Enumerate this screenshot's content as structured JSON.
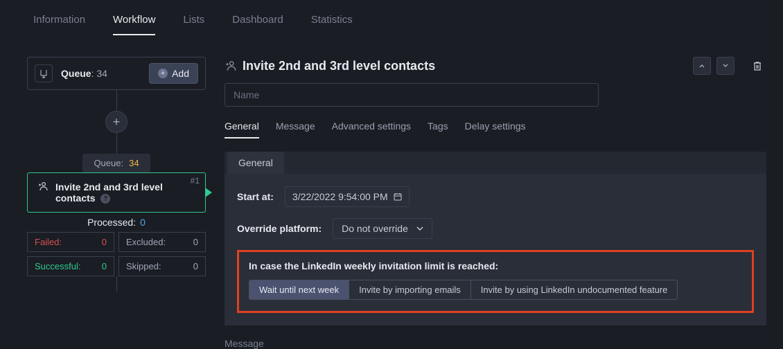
{
  "top_tabs": {
    "information": "Information",
    "workflow": "Workflow",
    "lists": "Lists",
    "dashboard": "Dashboard",
    "statistics": "Statistics"
  },
  "workflow": {
    "queue_label": "Queue",
    "queue_count": "34",
    "add_button": "Add",
    "queue_pill_label": "Queue:",
    "queue_pill_value": "34",
    "step": {
      "number": "#1",
      "title": "Invite 2nd and 3rd level contacts"
    },
    "processed_label": "Processed:",
    "processed_value": "0",
    "status": {
      "failed_label": "Failed:",
      "failed_value": "0",
      "excluded_label": "Excluded:",
      "excluded_value": "0",
      "successful_label": "Successful:",
      "successful_value": "0",
      "skipped_label": "Skipped:",
      "skipped_value": "0"
    }
  },
  "detail": {
    "title": "Invite 2nd and 3rd level contacts",
    "name_placeholder": "Name",
    "sub_tabs": {
      "general": "General",
      "message": "Message",
      "advanced": "Advanced settings",
      "tags": "Tags",
      "delay": "Delay settings"
    },
    "panel_tab": "General",
    "start_at_label": "Start at:",
    "start_at_value": "3/22/2022 9:54:00 PM",
    "override_label": "Override platform:",
    "override_value": "Do not override",
    "limit_label": "In case the LinkedIn weekly invitation limit is reached:",
    "limit_options": {
      "wait": "Wait until next week",
      "import": "Invite by importing emails",
      "undocumented": "Invite by using LinkedIn undocumented feature"
    },
    "message_section": "Message"
  }
}
